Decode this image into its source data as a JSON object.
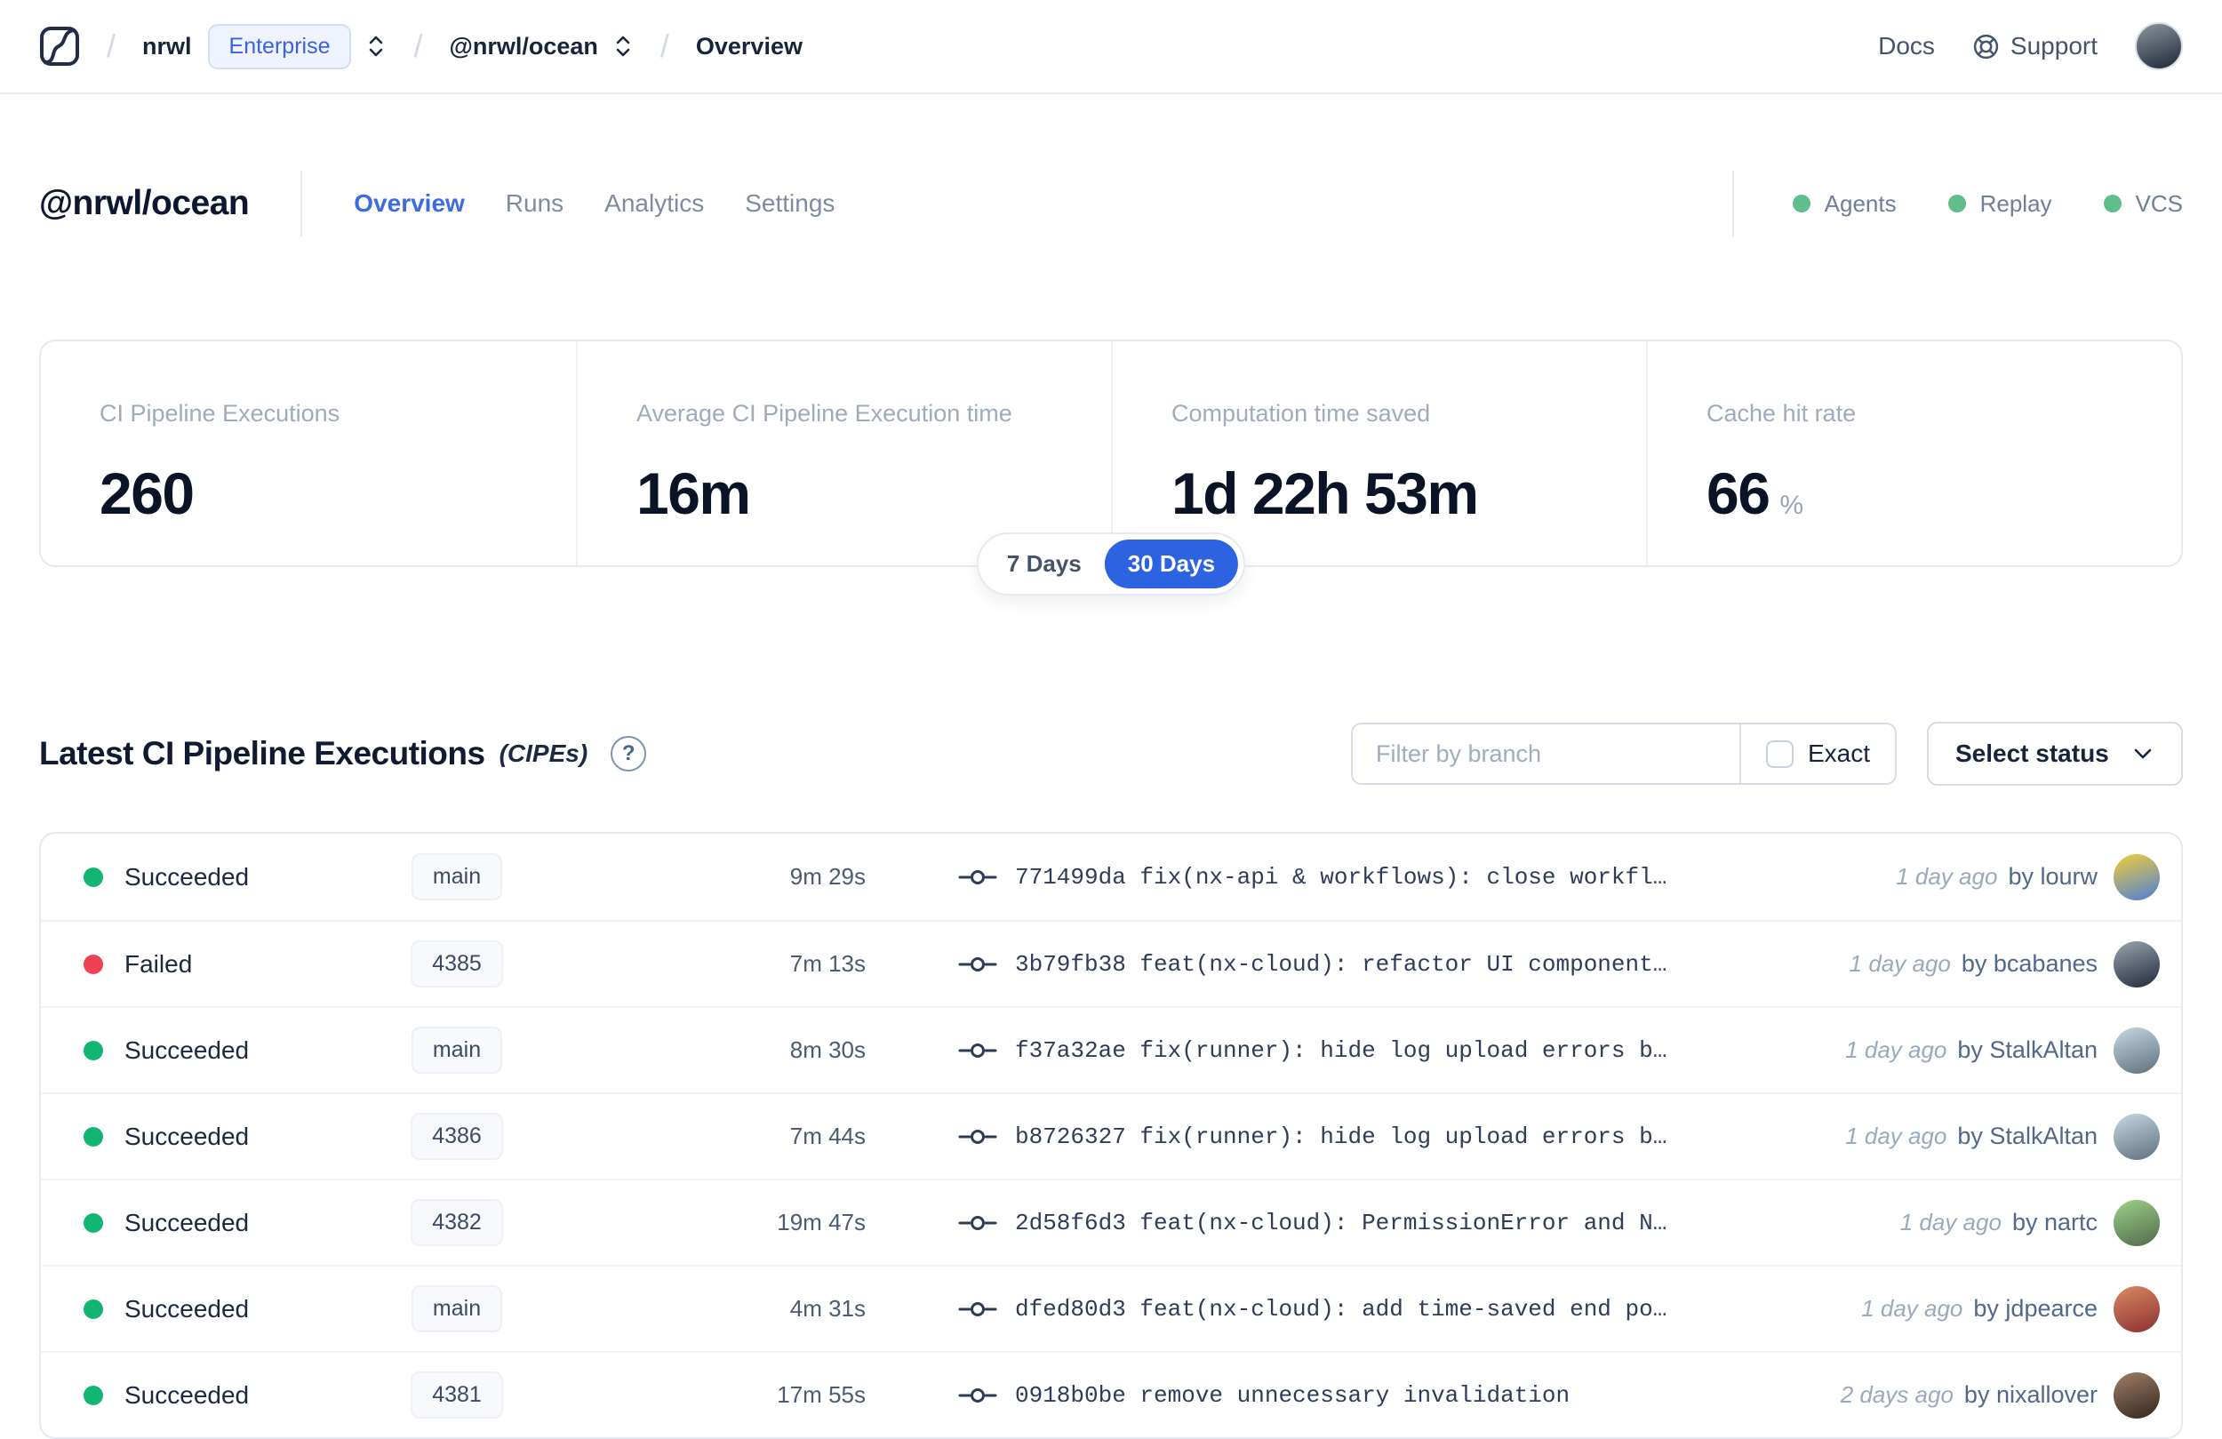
{
  "navbar": {
    "breadcrumb": {
      "org": "nrwl",
      "org_badge": "Enterprise",
      "workspace": "@nrwl/ocean",
      "page": "Overview"
    },
    "docs_label": "Docs",
    "support_label": "Support",
    "avatar_colors": [
      "#8c959e",
      "#1d2735"
    ]
  },
  "header": {
    "title": "@nrwl/ocean",
    "tabs": [
      {
        "label": "Overview",
        "active": true
      },
      {
        "label": "Runs",
        "active": false
      },
      {
        "label": "Analytics",
        "active": false
      },
      {
        "label": "Settings",
        "active": false
      }
    ],
    "statuses": [
      {
        "label": "Agents"
      },
      {
        "label": "Replay"
      },
      {
        "label": "VCS"
      }
    ],
    "status_dot_color": "#5fbe8a"
  },
  "stats": {
    "cards": [
      {
        "label": "CI Pipeline Executions",
        "value": "260",
        "suffix": ""
      },
      {
        "label": "Average CI Pipeline Execution time",
        "value": "16m",
        "suffix": ""
      },
      {
        "label": "Computation time saved",
        "value": "1d 22h 53m",
        "suffix": ""
      },
      {
        "label": "Cache hit rate",
        "value": "66",
        "suffix": "%"
      }
    ],
    "range_toggle": {
      "options": [
        "7 Days",
        "30 Days"
      ],
      "selected": "30 Days"
    }
  },
  "cipe_section": {
    "title": "Latest CI Pipeline Executions",
    "subtitle": "(CIPEs)",
    "help_glyph": "?",
    "filter_placeholder": "Filter by branch",
    "exact_label": "Exact",
    "exact_checked": false,
    "status_select_label": "Select status"
  },
  "colors": {
    "accent_blue": "#2d62e0",
    "success_green": "#12b672",
    "error_red": "#ee4254"
  },
  "table": {
    "rows": [
      {
        "status": "Succeeded",
        "dot": "#12b672",
        "branch": "main",
        "duration": "9m 29s",
        "commit": "771499da fix(nx-api & workflows): close workfl…",
        "time": "1 day ago",
        "author": "by lourw",
        "avatar": [
          "#f3cd3a",
          "#4c7fd8"
        ]
      },
      {
        "status": "Failed",
        "dot": "#ee4254",
        "branch": "4385",
        "duration": "7m 13s",
        "commit": "3b79fb38 feat(nx-cloud): refactor UI component…",
        "time": "1 day ago",
        "author": "by bcabanes",
        "avatar": [
          "#9aa5ae",
          "#20293a"
        ]
      },
      {
        "status": "Succeeded",
        "dot": "#12b672",
        "branch": "main",
        "duration": "8m 30s",
        "commit": "f37a32ae fix(runner): hide log upload errors b…",
        "time": "1 day ago",
        "author": "by StalkAltan",
        "avatar": [
          "#c6d8e0",
          "#5e707c"
        ]
      },
      {
        "status": "Succeeded",
        "dot": "#12b672",
        "branch": "4386",
        "duration": "7m 44s",
        "commit": "b8726327 fix(runner): hide log upload errors b…",
        "time": "1 day ago",
        "author": "by StalkAltan",
        "avatar": [
          "#c6d8e0",
          "#5e707c"
        ]
      },
      {
        "status": "Succeeded",
        "dot": "#12b672",
        "branch": "4382",
        "duration": "19m 47s",
        "commit": "2d58f6d3 feat(nx-cloud): PermissionError and N…",
        "time": "1 day ago",
        "author": "by nartc",
        "avatar": [
          "#9ed08a",
          "#4f6b4a"
        ]
      },
      {
        "status": "Succeeded",
        "dot": "#12b672",
        "branch": "main",
        "duration": "4m 31s",
        "commit": "dfed80d3 feat(nx-cloud): add time-saved end po…",
        "time": "1 day ago",
        "author": "by jdpearce",
        "avatar": [
          "#d98a64",
          "#8c3030"
        ]
      },
      {
        "status": "Succeeded",
        "dot": "#12b672",
        "branch": "4381",
        "duration": "17m 55s",
        "commit": "0918b0be remove unnecessary invalidation",
        "time": "2 days ago",
        "author": "by nixallover",
        "avatar": [
          "#a08066",
          "#33251d"
        ]
      }
    ]
  }
}
